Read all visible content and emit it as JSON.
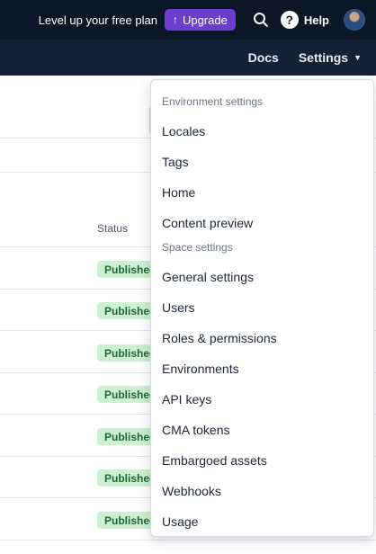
{
  "topbar": {
    "promo_text": "Level up your free plan",
    "upgrade_label": "Upgrade",
    "help_label": "Help",
    "bg_color": "#0b1627",
    "upgrade_color": "#6c3ecf"
  },
  "navbar": {
    "docs_label": "Docs",
    "settings_label": "Settings"
  },
  "table": {
    "status_header": "Status",
    "status_badges": [
      "Published",
      "Published",
      "Published",
      "Published",
      "Published",
      "Published",
      "Published"
    ],
    "badge_color": "#cdefd2"
  },
  "settings_menu": {
    "environment_group_label": "Environment settings",
    "environment_items": [
      "Locales",
      "Tags",
      "Home",
      "Content preview"
    ],
    "space_group_label": "Space settings",
    "space_items": [
      "General settings",
      "Users",
      "Roles & permissions",
      "Environments",
      "API keys",
      "CMA tokens",
      "Embargoed assets",
      "Webhooks",
      "Usage"
    ]
  }
}
